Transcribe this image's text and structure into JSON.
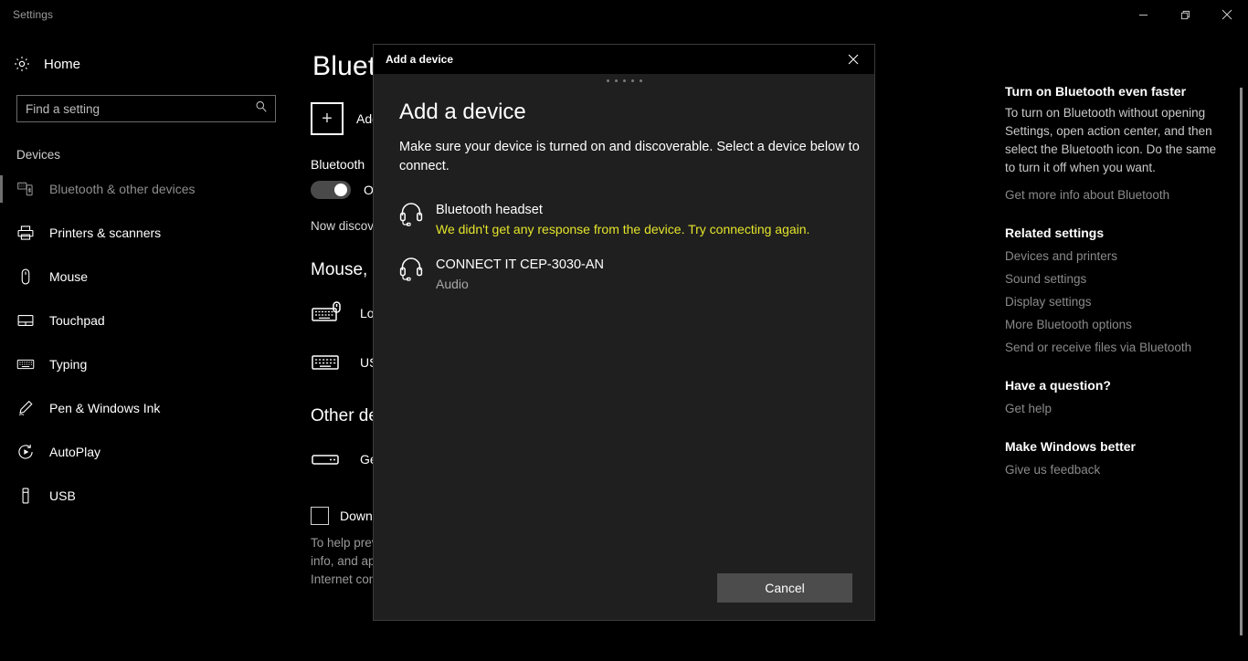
{
  "window": {
    "app_title": "Settings",
    "buttons": [
      {
        "name": "minimize",
        "glyph": "minimize-icon"
      },
      {
        "name": "restore",
        "glyph": "restore-icon"
      },
      {
        "name": "close",
        "glyph": "close-icon"
      }
    ]
  },
  "sidebar": {
    "home_label": "Home",
    "home_icon": "gear-icon",
    "search": {
      "placeholder": "Find a setting",
      "value": "",
      "icon": "search-icon"
    },
    "section_title": "Devices",
    "items": [
      {
        "label": "Bluetooth & other devices",
        "icon": "bluetooth-devices-icon",
        "selected": true
      },
      {
        "label": "Printers & scanners",
        "icon": "printer-icon",
        "selected": false
      },
      {
        "label": "Mouse",
        "icon": "mouse-icon",
        "selected": false
      },
      {
        "label": "Touchpad",
        "icon": "touchpad-icon",
        "selected": false
      },
      {
        "label": "Typing",
        "icon": "keyboard-icon",
        "selected": false
      },
      {
        "label": "Pen & Windows Ink",
        "icon": "pen-icon",
        "selected": false
      },
      {
        "label": "AutoPlay",
        "icon": "autoplay-icon",
        "selected": false
      },
      {
        "label": "USB",
        "icon": "usb-icon",
        "selected": false
      }
    ]
  },
  "main": {
    "page_title": "Bluetooth & other devices",
    "add_device": {
      "plus_glyph": "+",
      "label": "Add Bluetooth or other device"
    },
    "bluetooth_label": "Bluetooth",
    "bluetooth_state": "On",
    "discoverable_line": "Now discoverable as \"DESKTOP-PC\"",
    "mouse_group_title": "Mouse, keyboard, & pen",
    "mouse_devices": [
      {
        "name": "Logitech Wireless Keyboard",
        "icon": "keyboard-mouse-icon"
      },
      {
        "name": "USB Keyboard",
        "icon": "keyboard-icon"
      }
    ],
    "other_group_title": "Other devices",
    "other_devices": [
      {
        "name": "Generic Non-PnP Monitor",
        "icon": "device-icon"
      }
    ],
    "metered_checkbox_label": "Download over metered connections",
    "metered_note": "To help prevent extra charges, keep this off so device software (drivers, info, and apps) for new devices won't download while you're on metered Internet connections."
  },
  "right_panel": {
    "tip_title": "Turn on Bluetooth even faster",
    "tip_body": "To turn on Bluetooth without opening Settings, open action center, and then select the Bluetooth icon. Do the same to turn it off when you want.",
    "tip_link": "Get more info about Bluetooth",
    "related_title": "Related settings",
    "related_links": [
      "Devices and printers",
      "Sound settings",
      "Display settings",
      "More Bluetooth options",
      "Send or receive files via Bluetooth"
    ],
    "question_title": "Have a question?",
    "question_link": "Get help",
    "better_title": "Make Windows better",
    "better_link": "Give us feedback"
  },
  "dialog": {
    "titlebar_title": "Add a device",
    "close_icon": "close-icon",
    "progress_dots": 5,
    "heading": "Add a device",
    "subtitle": "Make sure your device is turned on and discoverable. Select a device below to connect.",
    "devices": [
      {
        "name": "Bluetooth headset",
        "status": "We didn't get any response from the device. Try connecting again.",
        "status_type": "warn",
        "icon": "headset-icon"
      },
      {
        "name": "CONNECT IT CEP-3030-AN",
        "status": "Audio",
        "status_type": "muted",
        "icon": "headset-icon"
      }
    ],
    "cancel_label": "Cancel"
  },
  "colors": {
    "background": "#000000",
    "dialog_background": "#1f1f1f",
    "warning_text": "#e4e42c",
    "button_face": "#4c4c4c",
    "muted_text": "#8a8a8a"
  }
}
